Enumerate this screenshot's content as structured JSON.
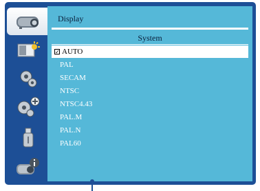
{
  "panel": {
    "title": "Display",
    "section_header": "System"
  },
  "sidebar": {
    "items": [
      {
        "icon": "projector-icon",
        "active": true
      },
      {
        "icon": "picture-adjust-icon",
        "active": false
      },
      {
        "icon": "gear-icon",
        "active": false
      },
      {
        "icon": "gear-plus-icon",
        "active": false
      },
      {
        "icon": "usb-drive-icon",
        "active": false
      },
      {
        "icon": "projector-info-icon",
        "active": false
      }
    ]
  },
  "options": [
    {
      "label": "AUTO",
      "selected": true,
      "checked": true
    },
    {
      "label": "PAL",
      "selected": false
    },
    {
      "label": "SECAM",
      "selected": false
    },
    {
      "label": "NTSC",
      "selected": false
    },
    {
      "label": "NTSC4.43",
      "selected": false
    },
    {
      "label": "PAL.M",
      "selected": false
    },
    {
      "label": "PAL.N",
      "selected": false
    },
    {
      "label": "PAL60",
      "selected": false
    }
  ],
  "colors": {
    "frame": "#1d4f96",
    "panel": "#55b8d8",
    "selected_row": "#ffffff"
  }
}
